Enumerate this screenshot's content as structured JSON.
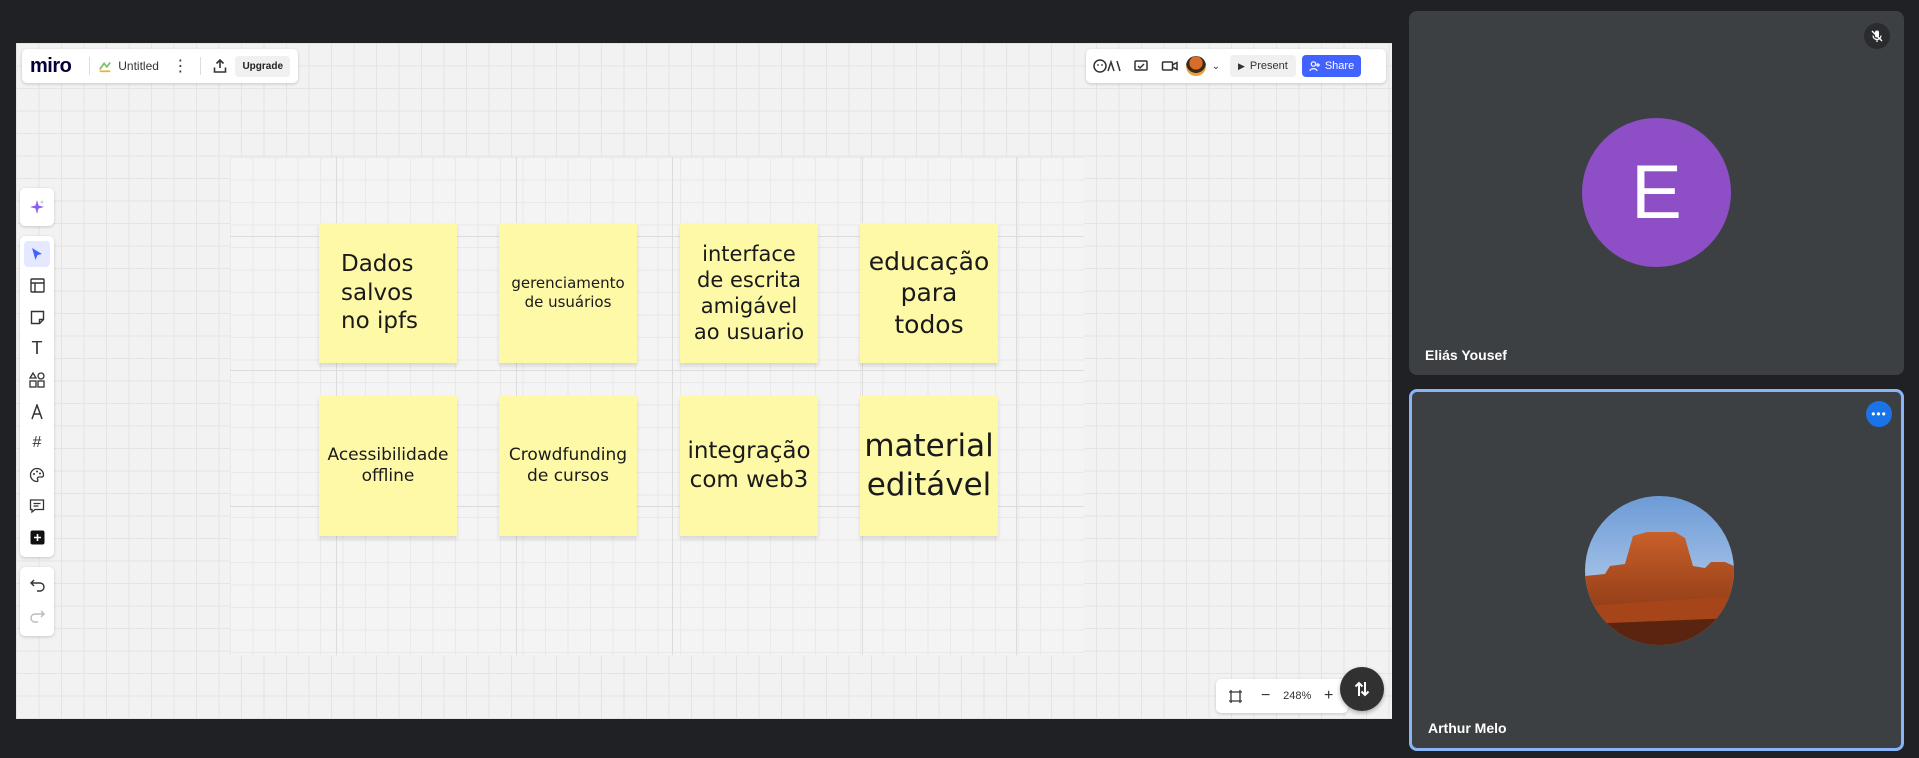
{
  "app": {
    "logo": "miro",
    "board_title": "Untitled",
    "upgrade_label": "Upgrade",
    "present_label": "Present",
    "share_label": "Share",
    "accent_color": "#4262ff"
  },
  "left_tools": [
    {
      "name": "ai-sparkle-icon"
    },
    {
      "name": "select-cursor-icon",
      "active": true
    },
    {
      "name": "templates-icon"
    },
    {
      "name": "sticky-note-icon"
    },
    {
      "name": "text-icon"
    },
    {
      "name": "shapes-icon"
    },
    {
      "name": "pen-icon"
    },
    {
      "name": "frame-icon"
    },
    {
      "name": "palette-icon"
    },
    {
      "name": "comment-icon"
    },
    {
      "name": "add-more-icon"
    },
    {
      "name": "undo-icon"
    },
    {
      "name": "redo-icon"
    }
  ],
  "stickies": [
    {
      "text": "Dados\nsalvos\nno ipfs"
    },
    {
      "text": "gerenciamento\nde usuários"
    },
    {
      "text": "interface\nde escrita\namigável\nao usuario"
    },
    {
      "text": "educação\npara\ntodos"
    },
    {
      "text": "Acessibilidade\noffline"
    },
    {
      "text": "Crowdfunding\nde cursos"
    },
    {
      "text": "integração\ncom web3"
    },
    {
      "text": "material\neditável"
    }
  ],
  "zoom": {
    "level": "248%"
  },
  "participants": [
    {
      "name": "Eliás Yousef",
      "initial": "E",
      "avatar_color": "#8e4fc6",
      "muted": true
    },
    {
      "name": "Arthur Melo",
      "avatar": "desert-mesa-photo",
      "active_speaker": true
    }
  ]
}
